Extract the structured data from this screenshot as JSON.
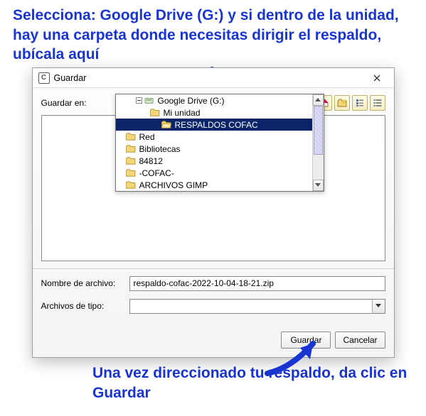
{
  "annotations": {
    "top": "Selecciona: Google Drive (G:) y si dentro de la unidad, hay una carpeta donde necesitas dirigir el respaldo, ubícala aquí",
    "bottom": "Una vez direccionado tu respaldo, da clic en Guardar"
  },
  "dialog": {
    "title": "Guardar",
    "guardar_en_label": "Guardar en:",
    "guardar_en_value": "RESPALDOS COFAC",
    "tree": [
      {
        "label": "Google Drive (G:)",
        "indent": 28,
        "icon": "drive"
      },
      {
        "label": "Mi unidad",
        "indent": 48,
        "icon": "folder"
      },
      {
        "label": "RESPALDOS COFAC",
        "indent": 64,
        "icon": "folder-open",
        "selected": true
      },
      {
        "label": "Red",
        "indent": 14,
        "icon": "folder"
      },
      {
        "label": "Bibliotecas",
        "indent": 14,
        "icon": "folder"
      },
      {
        "label": "84812",
        "indent": 14,
        "icon": "folder"
      },
      {
        "label": "-COFAC-",
        "indent": 14,
        "icon": "folder"
      },
      {
        "label": "ARCHIVOS GIMP",
        "indent": 14,
        "icon": "folder"
      }
    ],
    "nombre_label": "Nombre de archivo:",
    "nombre_value": "respaldo-cofac-2022-10-04-18-21.zip",
    "tipo_label": "Archivos de tipo:",
    "tipo_value": "",
    "guardar_btn": "Guardar",
    "cancelar_btn": "Cancelar",
    "toolbar_icons": [
      "up-folder-icon",
      "home-icon",
      "new-folder-icon",
      "list-view-icon",
      "details-view-icon"
    ]
  }
}
